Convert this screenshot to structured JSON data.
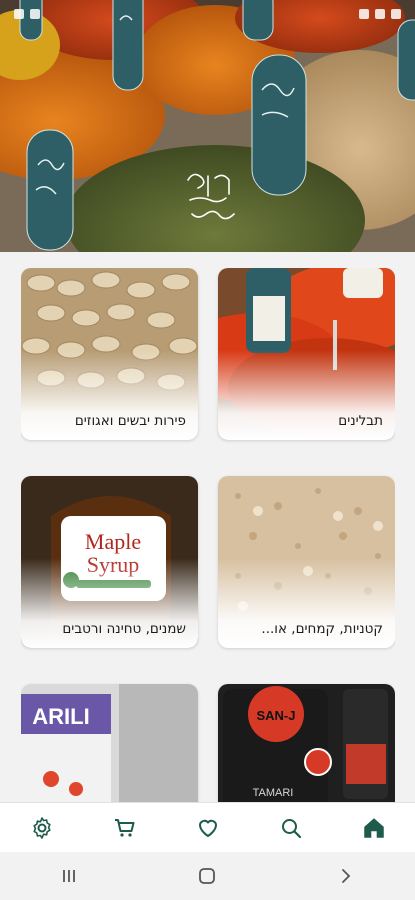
{
  "app": {
    "hero_logo_text": "תבלין\nשל\nפעם",
    "accent_color": "#1f5b4d"
  },
  "categories": [
    {
      "label": "תבלינים",
      "image": "spices-icon"
    },
    {
      "label": "פירות יבשים ואגוזים",
      "image": "nuts-icon"
    },
    {
      "label": "קטניות, קמחים, או...",
      "image": "flour-icon"
    },
    {
      "label": "שמנים, טחינה ורטבים",
      "image": "syrup-icon"
    },
    {
      "label": "",
      "image": "sauce-bottles-icon"
    },
    {
      "label": "",
      "image": "snack-bags-icon"
    }
  ],
  "product_text": {
    "maple_line1": "Maple",
    "maple_line2": "Syrup",
    "sanj_brand": "SAN-J",
    "tamari": "TAMARI",
    "arili": "ARILI"
  },
  "bottom_nav": [
    "home-icon",
    "search-icon",
    "heart-icon",
    "cart-icon",
    "settings-icon"
  ],
  "system_nav": [
    "back-icon",
    "home-circle-icon",
    "recents-icon"
  ]
}
